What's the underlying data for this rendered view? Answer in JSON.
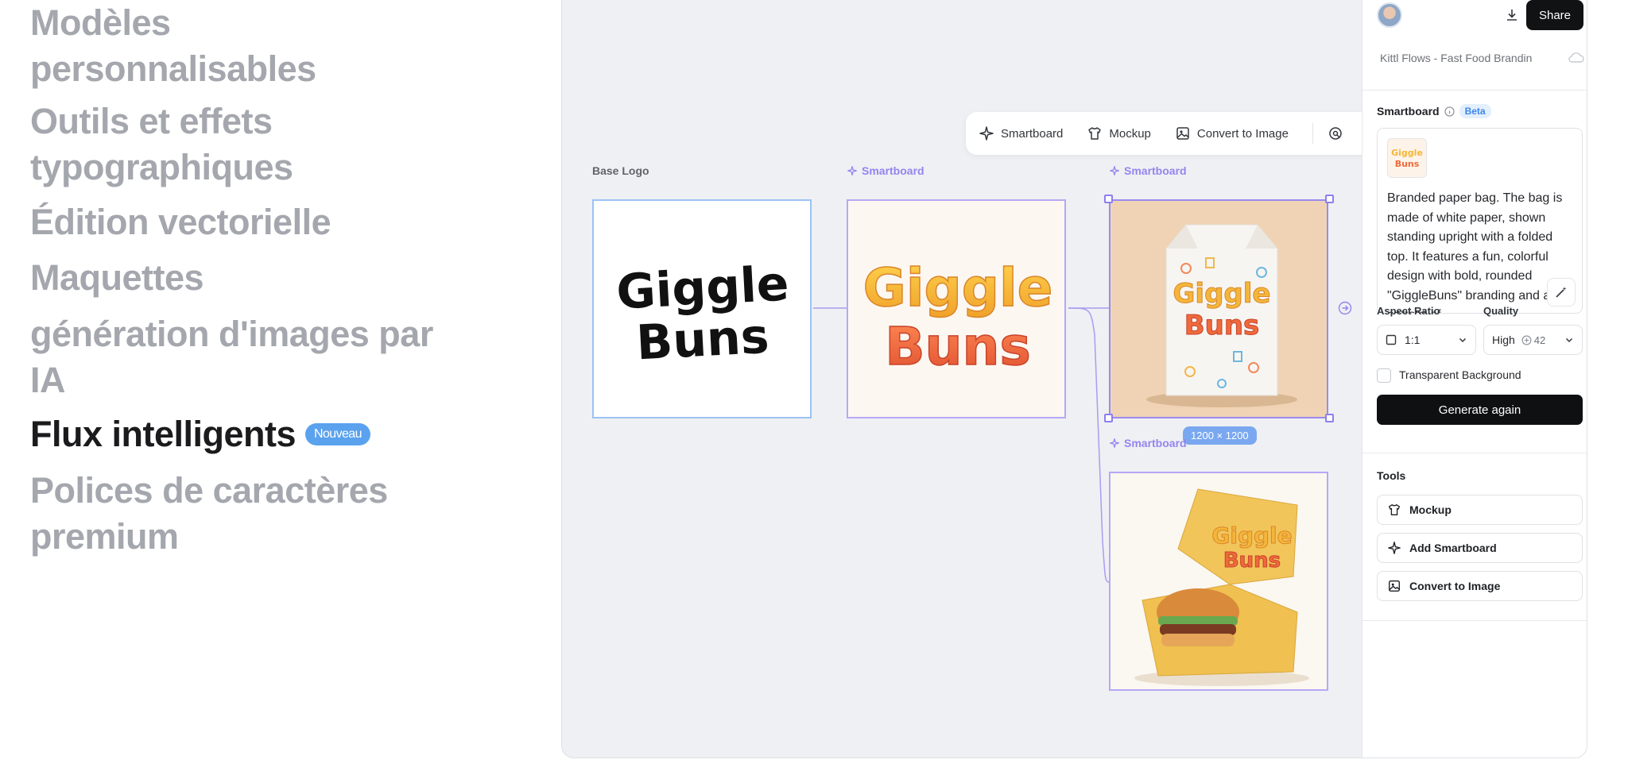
{
  "features": [
    {
      "label": "Modèles personnalisables"
    },
    {
      "label": "Outils et effets typographiques"
    },
    {
      "label": "Édition vectorielle"
    },
    {
      "label": "Maquettes"
    },
    {
      "label": "génération d'images par IA"
    },
    {
      "label": "Flux intelligents",
      "badge": "Nouveau",
      "active": true
    },
    {
      "label": "Polices de caractères premium"
    }
  ],
  "toolbar": {
    "smartboard_label": "Smartboard",
    "mockup_label": "Mockup",
    "convert_label": "Convert to Image"
  },
  "nodes": {
    "base_label": "Base Logo",
    "sb1_label": "Smartboard",
    "sb2_label": "Smartboard",
    "sb3_label": "Smartboard",
    "logo_line1": "Giggle",
    "logo_line2": "Buns",
    "dimensions": "1200 × 1200"
  },
  "panel": {
    "share_label": "Share",
    "doc_title": "Kittl Flows - Fast Food Brandin",
    "smartboard_title": "Smartboard",
    "beta_badge": "Beta",
    "prompt": "Branded paper bag. The bag is made of white paper, shown standing upright with a folded top. It features a fun, colorful design with bold, rounded \"GiggleBuns\" branding and a pattern of",
    "aspect_ratio_label": "Aspect Ratio",
    "aspect_ratio_value": "1:1",
    "quality_label": "Quality",
    "quality_value": "High",
    "quality_credits": "42",
    "transparent_label": "Transparent Background",
    "generate_label": "Generate again",
    "tools_title": "Tools",
    "tools": [
      {
        "label": "Mockup",
        "icon": "shirt-icon"
      },
      {
        "label": "Add Smartboard",
        "icon": "sparkle-icon"
      },
      {
        "label": "Convert to Image",
        "icon": "image-icon"
      }
    ]
  },
  "colors": {
    "accent_purple": "#9385f0",
    "accent_blue": "#5aa2ee",
    "primary_button": "#0f1012"
  }
}
